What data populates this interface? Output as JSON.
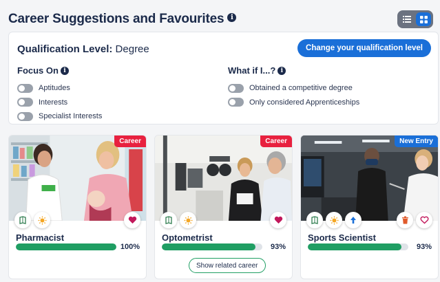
{
  "header": {
    "title": "Career Suggestions and Favourites",
    "info_glyph": "i"
  },
  "view_toggle": {
    "options": [
      "list-view",
      "grid-view"
    ],
    "active": "grid-view"
  },
  "qualification": {
    "label": "Qualification Level:",
    "value": "Degree",
    "change_button": "Change your qualification level"
  },
  "focus_on": {
    "title": "Focus On",
    "toggles": [
      "Aptitudes",
      "Interests",
      "Specialist Interests"
    ]
  },
  "what_if": {
    "title": "What if I...?",
    "toggles": [
      "Obtained a competitive degree",
      "Only considered Apprenticeships"
    ]
  },
  "cards": [
    {
      "name": "Pharmacist",
      "badge": "Career",
      "percent_label": "100%",
      "match": 100,
      "icons": [
        "map-book-icon",
        "sun-icon"
      ],
      "right_icons": [
        "heart-icon"
      ]
    },
    {
      "name": "Optometrist",
      "badge": "Career",
      "percent_label": "93%",
      "match": 93,
      "icons": [
        "map-book-icon",
        "sun-icon"
      ],
      "right_icons": [
        "heart-icon"
      ],
      "related_button": "Show related career"
    },
    {
      "name": "Sports Scientist",
      "badge": "New Entry",
      "percent_label": "93%",
      "match": 93,
      "icons": [
        "map-book-icon",
        "sun-icon",
        "arrow-up-icon"
      ],
      "right_icons": [
        "trash-icon",
        "heart-outline-icon"
      ]
    }
  ],
  "colors": {
    "primary": "#1a6fd8",
    "career_badge": "#e8213f",
    "progress": "#1f9e63",
    "heading": "#1b2a4a",
    "heart": "#c2185b"
  }
}
